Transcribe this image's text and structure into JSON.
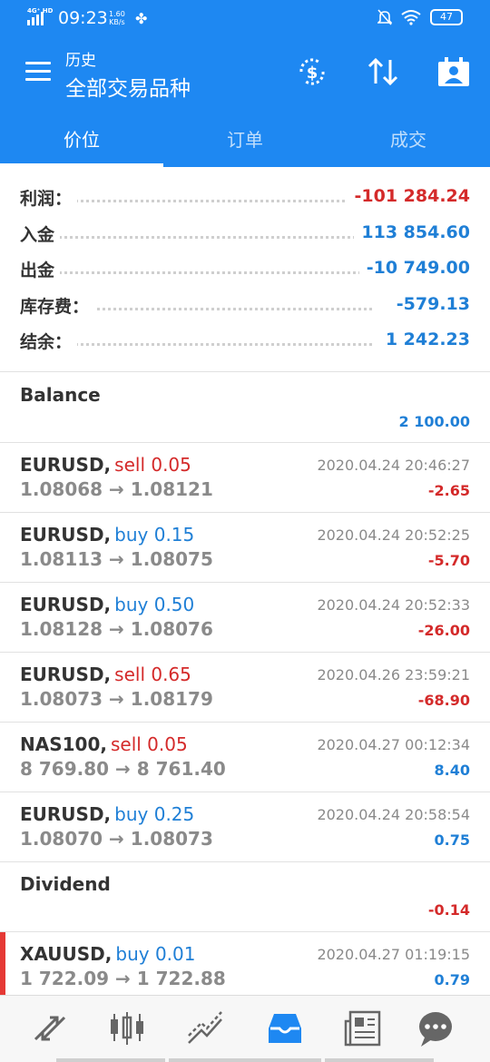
{
  "status": {
    "network": "4G⁺ HD",
    "time": "09:23",
    "speed_value": "1.60",
    "speed_unit": "KB/s",
    "battery": "47"
  },
  "header": {
    "subtitle": "历史",
    "title": "全部交易品种",
    "tabs": [
      {
        "label": "价位",
        "active": true
      },
      {
        "label": "订单",
        "active": false
      },
      {
        "label": "成交",
        "active": false
      }
    ]
  },
  "summary": [
    {
      "label": "利润：",
      "value": "-101 284.24",
      "color": "#d42a2a"
    },
    {
      "label": "入金",
      "value": "113 854.60",
      "color": "#1f7fd6"
    },
    {
      "label": "出金",
      "value": "-10 749.00",
      "color": "#1f7fd6"
    },
    {
      "label": "库存费：",
      "value": "-579.13",
      "color": "#1f7fd6"
    },
    {
      "label": "结余：",
      "value": "1 242.23",
      "color": "#1f7fd6"
    }
  ],
  "balance": {
    "title": "Balance",
    "value": "2 100.00"
  },
  "deals": [
    {
      "symbol": "EURUSD,",
      "side": "sell 0.05",
      "side_color": "#d42a2a",
      "prices": "1.08068 → 1.08121",
      "time": "2020.04.24 20:46:27",
      "profit": "-2.65",
      "profit_color": "#d42a2a"
    },
    {
      "symbol": "EURUSD,",
      "side": "buy 0.15",
      "side_color": "#1f7fd6",
      "prices": "1.08113 → 1.08075",
      "time": "2020.04.24 20:52:25",
      "profit": "-5.70",
      "profit_color": "#d42a2a"
    },
    {
      "symbol": "EURUSD,",
      "side": "buy 0.50",
      "side_color": "#1f7fd6",
      "prices": "1.08128 → 1.08076",
      "time": "2020.04.24 20:52:33",
      "profit": "-26.00",
      "profit_color": "#d42a2a"
    },
    {
      "symbol": "EURUSD,",
      "side": "sell 0.65",
      "side_color": "#d42a2a",
      "prices": "1.08073 → 1.08179",
      "time": "2020.04.26 23:59:21",
      "profit": "-68.90",
      "profit_color": "#d42a2a"
    },
    {
      "symbol": "NAS100,",
      "side": "sell 0.05",
      "side_color": "#d42a2a",
      "prices": "8 769.80 → 8 761.40",
      "time": "2020.04.27 00:12:34",
      "profit": "8.40",
      "profit_color": "#1f7fd6"
    },
    {
      "symbol": "EURUSD,",
      "side": "buy 0.25",
      "side_color": "#1f7fd6",
      "prices": "1.08070 → 1.08073",
      "time": "2020.04.24 20:58:54",
      "profit": "0.75",
      "profit_color": "#1f7fd6"
    }
  ],
  "dividend": {
    "title": "Dividend",
    "value": "-0.14"
  },
  "last_deal": {
    "symbol": "XAUUSD,",
    "side": "buy 0.01",
    "side_color": "#1f7fd6",
    "prices": "1 722.09 → 1 722.88",
    "time": "2020.04.27 01:19:15",
    "profit": "0.79",
    "profit_color": "#1f7fd6"
  },
  "bottom_nav": [
    {
      "icon": "quotes-icon",
      "active": false
    },
    {
      "icon": "chart-icon",
      "active": false
    },
    {
      "icon": "trade-icon",
      "active": false
    },
    {
      "icon": "history-icon",
      "active": true
    },
    {
      "icon": "news-icon",
      "active": false
    },
    {
      "icon": "chat-icon",
      "active": false
    }
  ],
  "colors": {
    "primary": "#1e88f2",
    "loss": "#d42a2a",
    "profit": "#1f7fd6",
    "muted": "#8a8a8a"
  }
}
